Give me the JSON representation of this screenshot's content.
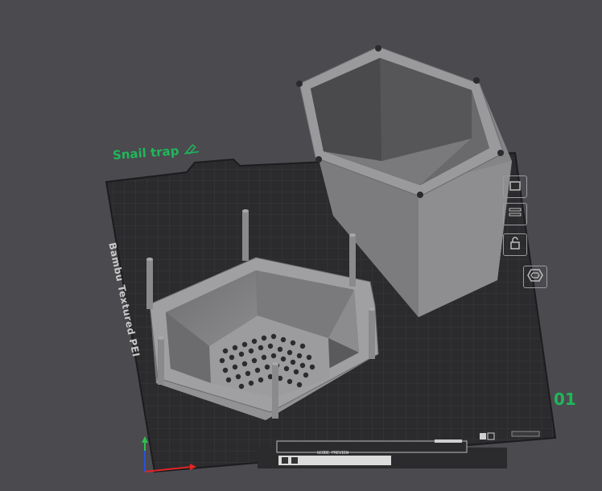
{
  "plate": {
    "name": "Snail trap",
    "number": "01",
    "brand_text": "Bambu Textured PEI",
    "footer_text": "GCODE PREVIEW"
  },
  "icons": {
    "edit": "pencil-icon",
    "arrange": "hexagon-arrange-icon",
    "lock": "lock-icon",
    "settings": "plate-settings-icon",
    "orient": "auto-orient-icon"
  },
  "colors": {
    "background": "#4a4a4f",
    "plate": "#2b2b2d",
    "grid": "#3e3e42",
    "model": "#8a8a8c",
    "accent": "#1fb85a",
    "axis_x": "#e12525",
    "axis_y": "#2fbf4f",
    "axis_z": "#2a4fd8"
  }
}
